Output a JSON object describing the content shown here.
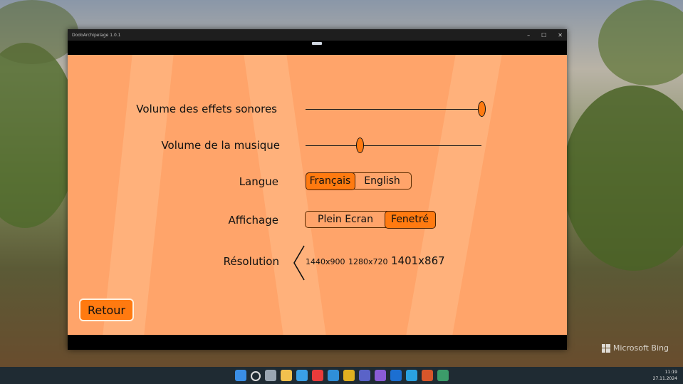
{
  "window": {
    "title": "DodoArchipelage 1.0.1",
    "controls": {
      "minimize": "–",
      "maximize": "☐",
      "close": "✕"
    }
  },
  "settings": {
    "sfx_volume": {
      "label": "Volume des effets sonores",
      "value": 1.0
    },
    "music_volume": {
      "label": "Volume de la musique",
      "value": 0.31
    },
    "language": {
      "label": "Langue",
      "options": [
        "Français",
        "English"
      ],
      "selected": "Français"
    },
    "display": {
      "label": "Affichage",
      "options": [
        "Plein Ecran",
        "Fenetré"
      ],
      "selected": "Fenetré"
    },
    "resolution": {
      "label": "Résolution",
      "options": [
        "1440x900",
        "1280x720",
        "1401x867"
      ],
      "selected": "1401x867"
    }
  },
  "back_button": {
    "label": "Retour"
  },
  "desktop": {
    "bing_label": "Microsoft Bing"
  },
  "taskbar": {
    "icons": [
      "windows-start-icon",
      "search-icon",
      "task-view-icon",
      "file-explorer-icon",
      "notepad-icon",
      "yandex-icon",
      "edge-icon",
      "chrome-icon",
      "save-icon",
      "visual-studio-icon",
      "outlook-icon",
      "telegram-icon",
      "game-icon",
      "globe-icon"
    ],
    "time": "11:19",
    "date": "27.11.2024"
  },
  "colors": {
    "game_bg": "#ffa46a",
    "accent": "#ff7a10",
    "ray": "#ffb47e"
  }
}
